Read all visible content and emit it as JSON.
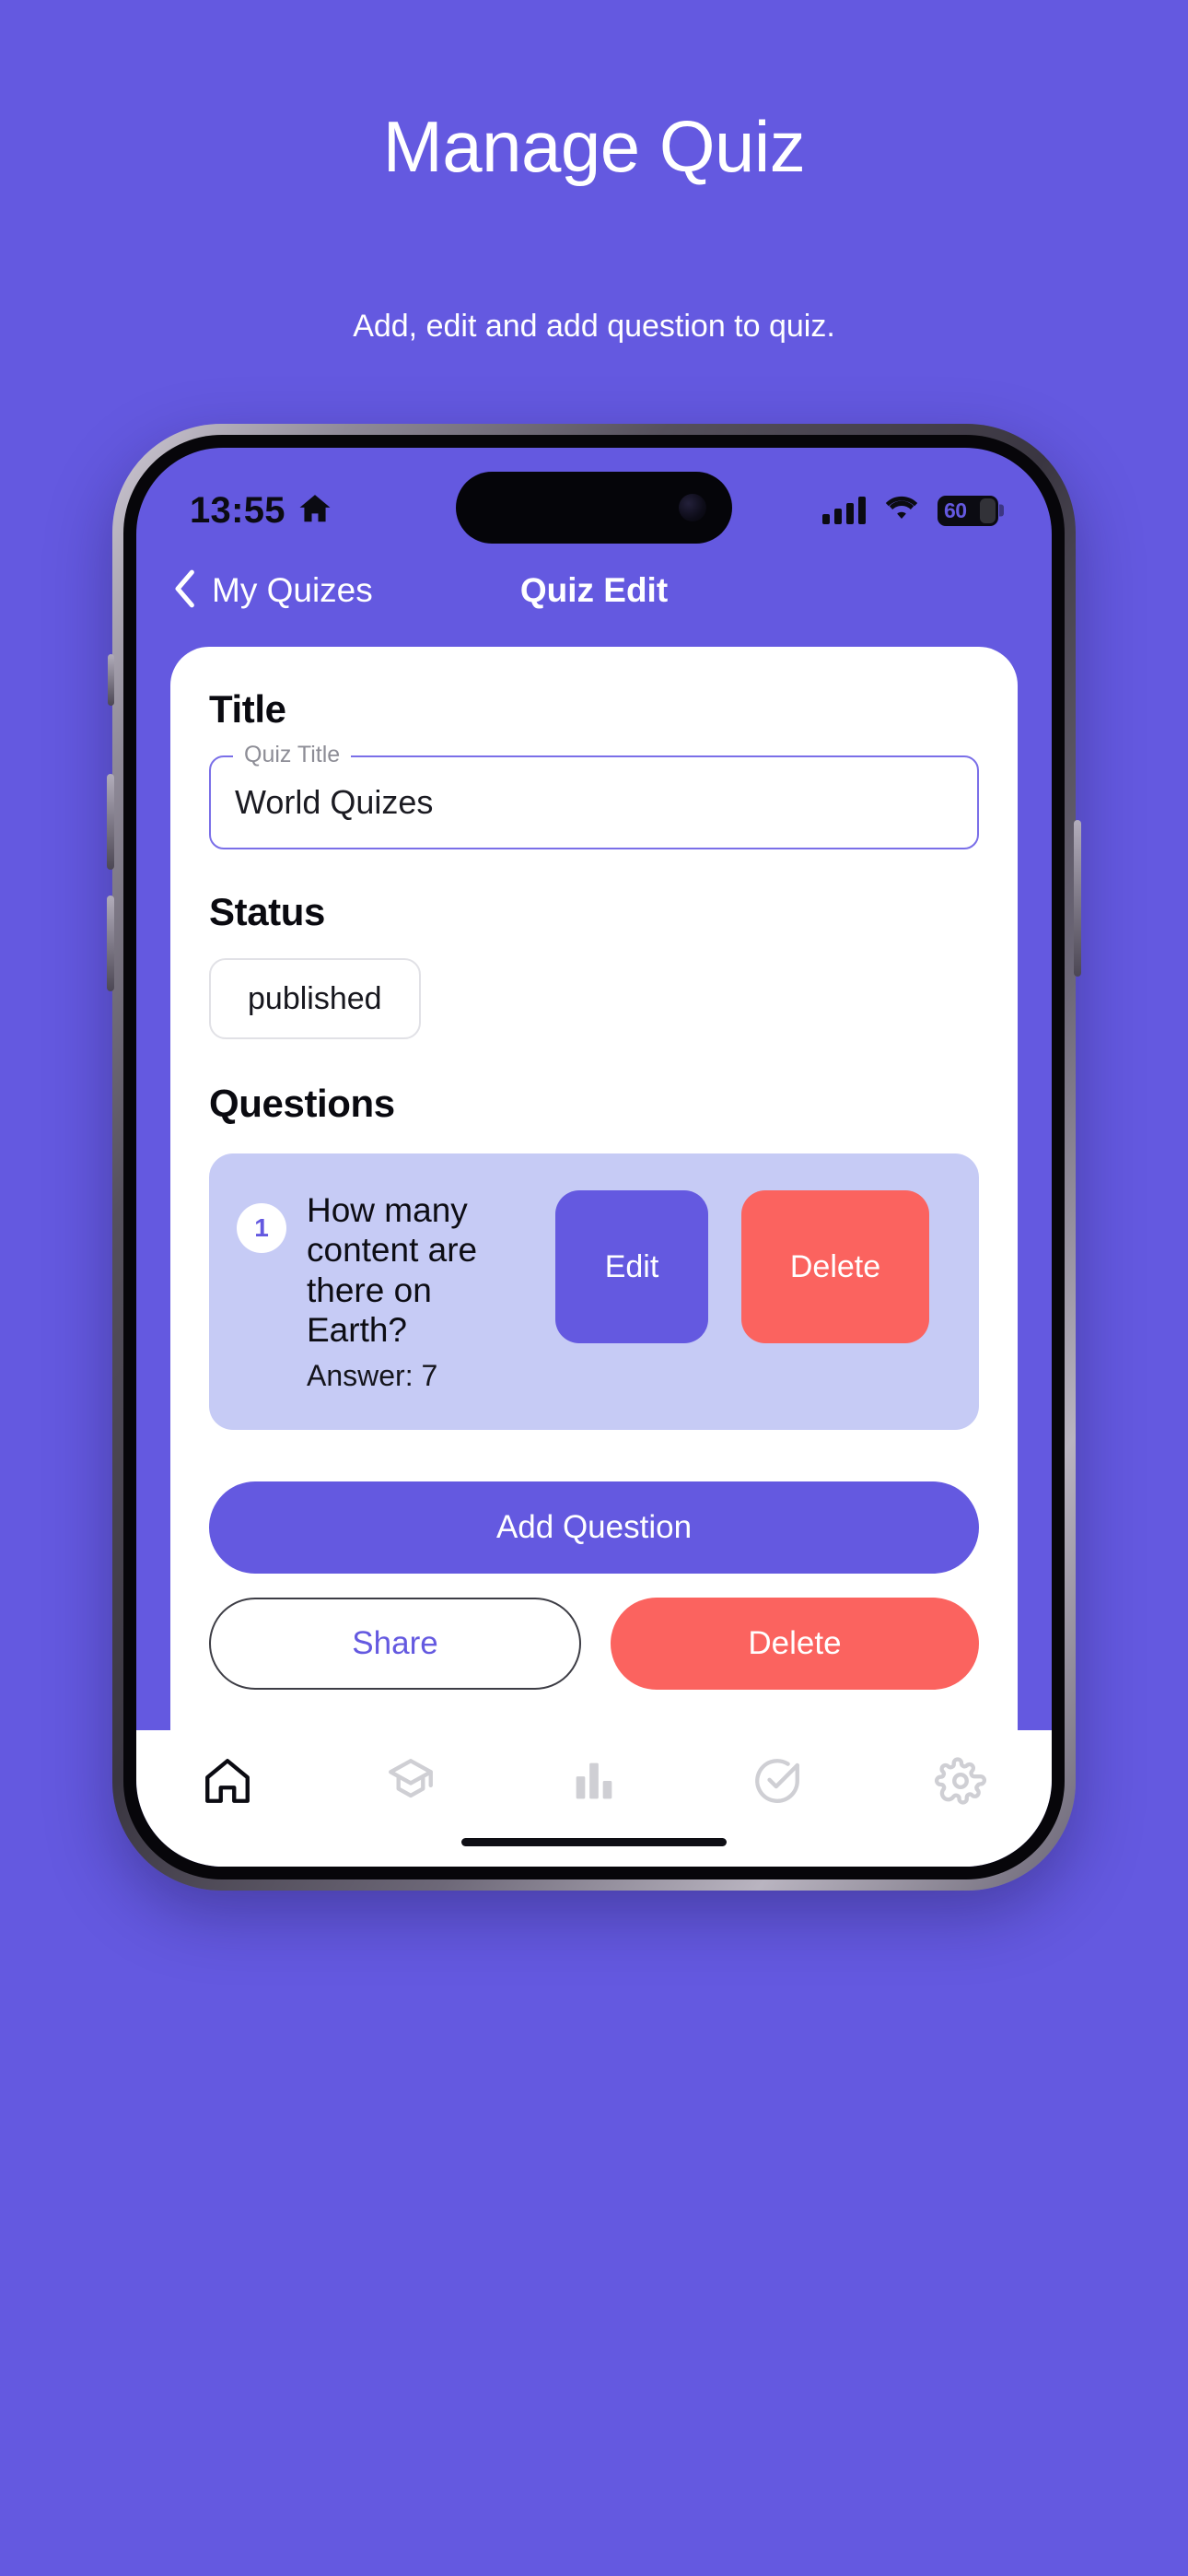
{
  "promo": {
    "title": "Manage Quiz",
    "subtitle": "Add, edit and add question to quiz.",
    "background_color": "#6459e0"
  },
  "status_bar": {
    "time": "13:55",
    "home_icon": "home-icon",
    "signal_icon": "cellular-signal-icon",
    "signal_bars": 4,
    "wifi_icon": "wifi-icon",
    "battery_level": "60",
    "battery_icon": "battery-icon"
  },
  "nav": {
    "back_icon": "chevron-left-icon",
    "back_label": "My Quizes",
    "title": "Quiz Edit"
  },
  "form": {
    "title_section_heading": "Title",
    "quiz_title_label": "Quiz Title",
    "quiz_title_value": "World Quizes",
    "quiz_title_placeholder": "Quiz Title",
    "status_section_heading": "Status",
    "status_value": "published",
    "questions_section_heading": "Questions"
  },
  "questions": [
    {
      "number": "1",
      "text": "How many content are there on Earth?",
      "answer_label": "Answer: 7",
      "edit_label": "Edit",
      "delete_label": "Delete"
    }
  ],
  "actions": {
    "add_question": "Add Question",
    "share": "Share",
    "delete": "Delete"
  },
  "tabbar": {
    "items": [
      {
        "name": "tab-home",
        "icon": "home-icon",
        "active": true
      },
      {
        "name": "tab-learn",
        "icon": "graduation-cap-icon",
        "active": false
      },
      {
        "name": "tab-stats",
        "icon": "bar-chart-icon",
        "active": false
      },
      {
        "name": "tab-tasks",
        "icon": "check-circle-icon",
        "active": false
      },
      {
        "name": "tab-settings",
        "icon": "gear-icon",
        "active": false
      }
    ]
  },
  "colors": {
    "brand_purple": "#6459e0",
    "danger_red": "#fb635f",
    "question_card": "#c6cbf5",
    "field_border": "#7a6fe8"
  }
}
